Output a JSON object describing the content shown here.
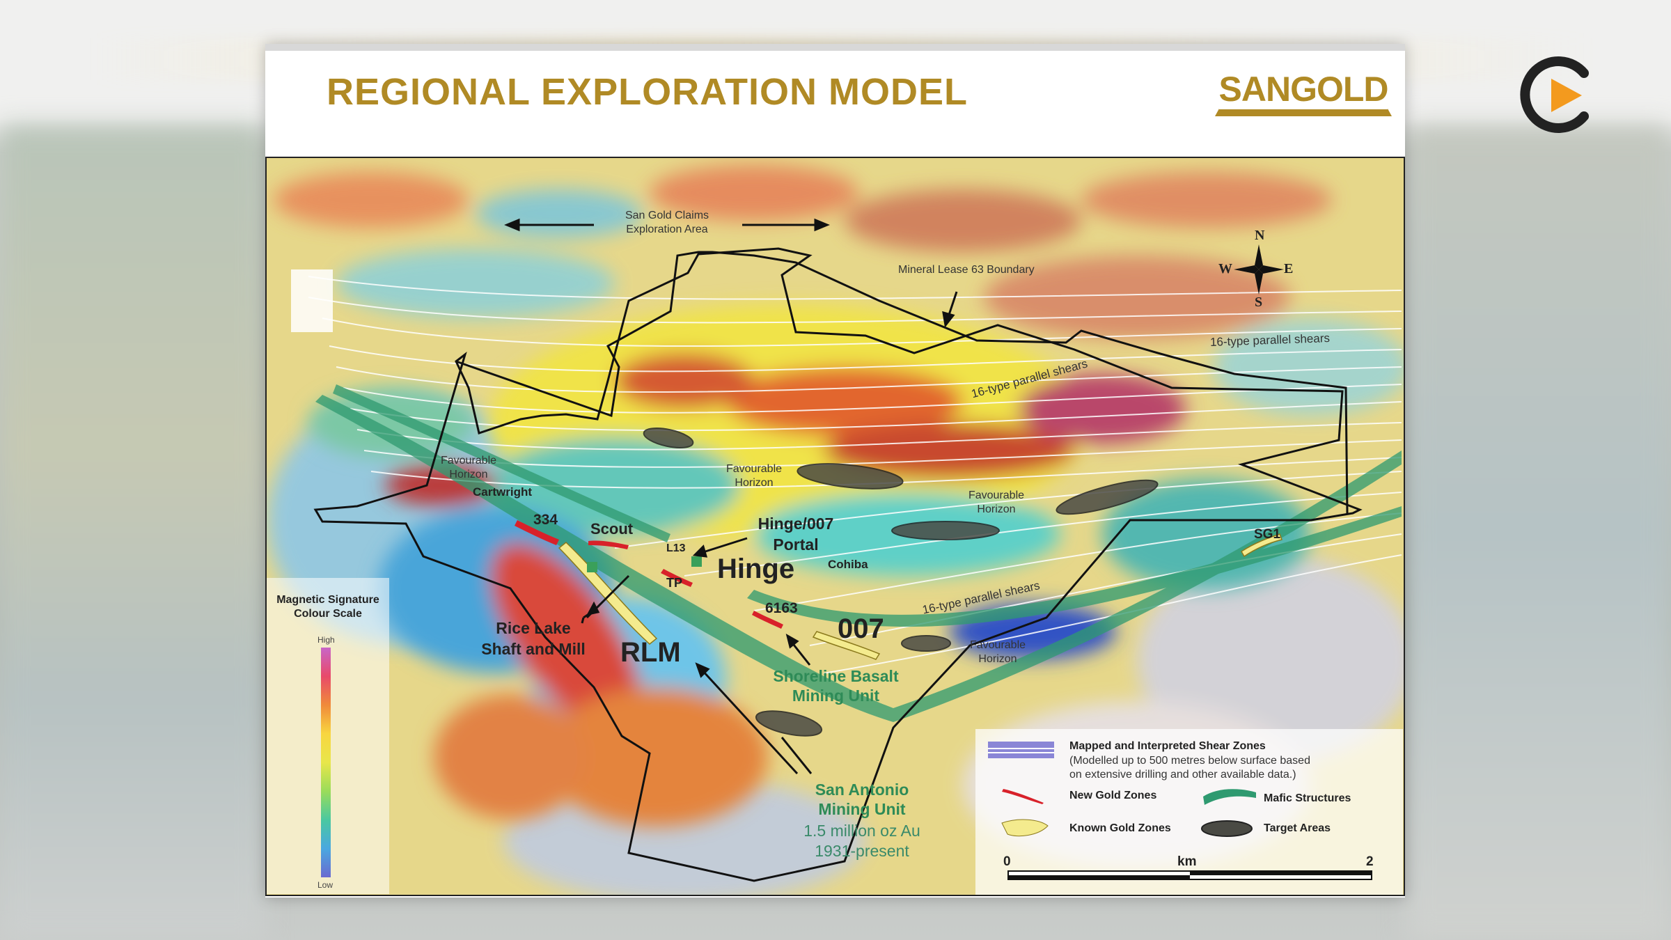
{
  "slide": {
    "title": "REGIONAL EXPLORATION MODEL",
    "logo_text": "SANGOLD"
  },
  "map": {
    "exploration_area": [
      "San Gold Claims",
      "Exploration Area"
    ],
    "lease_boundary": "Mineral Lease 63 Boundary",
    "compass": {
      "n": "N",
      "s": "S",
      "e": "E",
      "w": "W"
    },
    "shears": {
      "top_right": "16-type parallel shears",
      "middle": "16-type parallel shears",
      "lower": "16-type parallel shears"
    },
    "favourable": {
      "left": [
        "Favourable",
        "Horizon"
      ],
      "center": [
        "Favourable",
        "Horizon"
      ],
      "right": [
        "Favourable",
        "Horizon"
      ],
      "lower": [
        "Favourable",
        "Horizon"
      ]
    },
    "places": {
      "cartwright": "Cartwright",
      "z334": "334",
      "scout": "Scout",
      "l13": "L13",
      "tp": "TP",
      "hinge_portal": [
        "Hinge/007",
        "Portal"
      ],
      "hinge": "Hinge",
      "cohiba": "Cohiba",
      "z6163": "6163",
      "z007": "007",
      "sg1": "SG1",
      "rlm": "RLM",
      "rice_lake": [
        "Rice Lake",
        "Shaft and Mill"
      ],
      "shoreline": [
        "Shoreline Basalt",
        "Mining Unit"
      ],
      "san_antonio": [
        "San Antonio",
        "Mining Unit"
      ],
      "san_antonio_stats": [
        "1.5 million oz Au",
        "1931-present"
      ]
    },
    "mag_scale": {
      "title": [
        "Magnetic Signature",
        "Colour Scale"
      ],
      "high": "High",
      "low": "Low"
    },
    "legend": {
      "shear_zones": "Mapped and Interpreted Shear Zones",
      "shear_note": [
        "(Modelled up to 500 metres below surface based",
        "on extensive drilling and other available data.)"
      ],
      "new_gold": "New Gold Zones",
      "mafic": "Mafic Structures",
      "known_gold": "Known Gold Zones",
      "targets": "Target Areas",
      "scale_start": "0",
      "scale_unit": "km",
      "scale_end": "2"
    }
  }
}
